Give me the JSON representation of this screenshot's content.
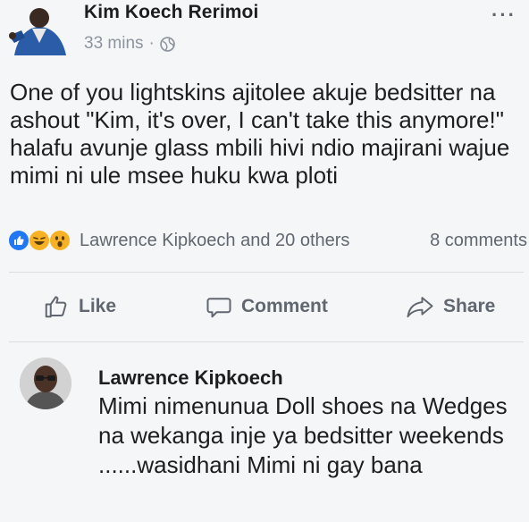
{
  "post": {
    "author": "Kim Koech Rerimoi",
    "time": "33 mins",
    "separator": "·",
    "more": "···",
    "text": "One of you lightskins ajitolee akuje bedsitter na ashout \"Kim, it's over, I can't take this anymore!\" halafu avunje glass mbili hivi ndio majirani wajue mimi ni ule msee huku kwa ploti"
  },
  "reactions": {
    "icons": [
      "like-icon",
      "laugh-icon",
      "wow-icon"
    ],
    "reactors": "Lawrence Kipkoech and 20 others",
    "comments_count": "8 comments"
  },
  "actions": {
    "like": "Like",
    "comment": "Comment",
    "share": "Share"
  },
  "comment": {
    "author": "Lawrence Kipkoech",
    "text": "Mimi nimenunua Doll shoes na Wedges na wekanga inje ya bedsitter weekends ......wasidhani Mimi ni gay bana"
  },
  "colors": {
    "background": "#f5f6f7",
    "text": "#1c1e21",
    "muted": "#606770",
    "meta": "#8d949e",
    "like_blue": "#2078f4",
    "emoji_yellow": "#f7b125"
  }
}
